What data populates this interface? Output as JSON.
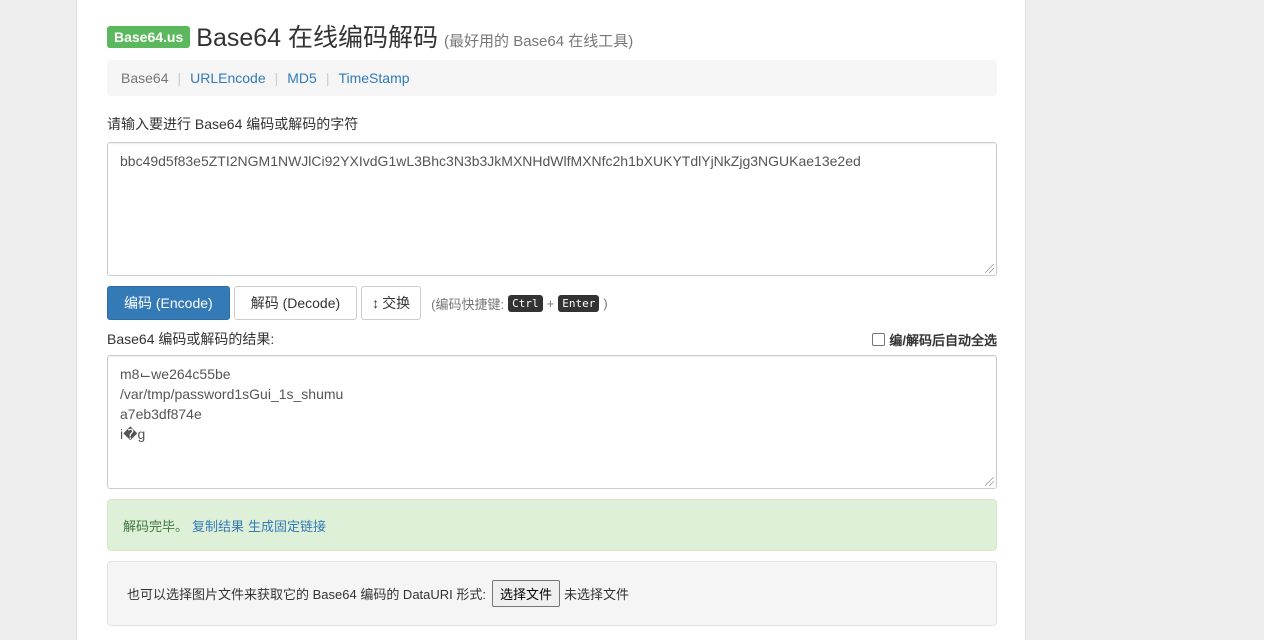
{
  "header": {
    "badge": "Base64.us",
    "title": "Base64 在线编码解码",
    "subtitle": "(最好用的 Base64 在线工具)"
  },
  "nav": {
    "items": [
      "Base64",
      "URLEncode",
      "MD5",
      "TimeStamp"
    ],
    "separator": "|"
  },
  "input": {
    "label": "请输入要进行 Base64 编码或解码的字符",
    "value": "bbc49d5f83e5ZTI2NGM1NWJlCi92YXIvdG1wL3Bhc3N3b3JkMXNHdWlfMXNfc2h1bXUKYTdlYjNkZjg3NGUKae13e2ed"
  },
  "buttons": {
    "encode": "编码 (Encode)",
    "decode": "解码 (Decode)",
    "swap_arrow": "↕",
    "swap": "交换"
  },
  "shortcut": {
    "prefix": "(编码快捷键:",
    "key1": "Ctrl",
    "plus": "+",
    "key2": "Enter",
    "suffix": ")"
  },
  "output": {
    "label": "Base64 编码或解码的结果:",
    "auto_select": "编/解码后自动全选",
    "lines": [
      "m8⌙we264c55be",
      "/var/tmp/password1sGui_1s_shumu",
      "a7eb3df874e",
      "i�g"
    ]
  },
  "status": {
    "message": "解码完毕。",
    "copy_link": "复制结果",
    "permalink": "生成固定链接"
  },
  "file": {
    "label": "也可以选择图片文件来获取它的 Base64 编码的 DataURI 形式:",
    "button": "选择文件",
    "none_selected": "未选择文件"
  },
  "colors": {
    "primary": "#337ab7",
    "badge": "#5cb85c",
    "success_bg": "#dff0d8",
    "success_text": "#3c763d"
  }
}
